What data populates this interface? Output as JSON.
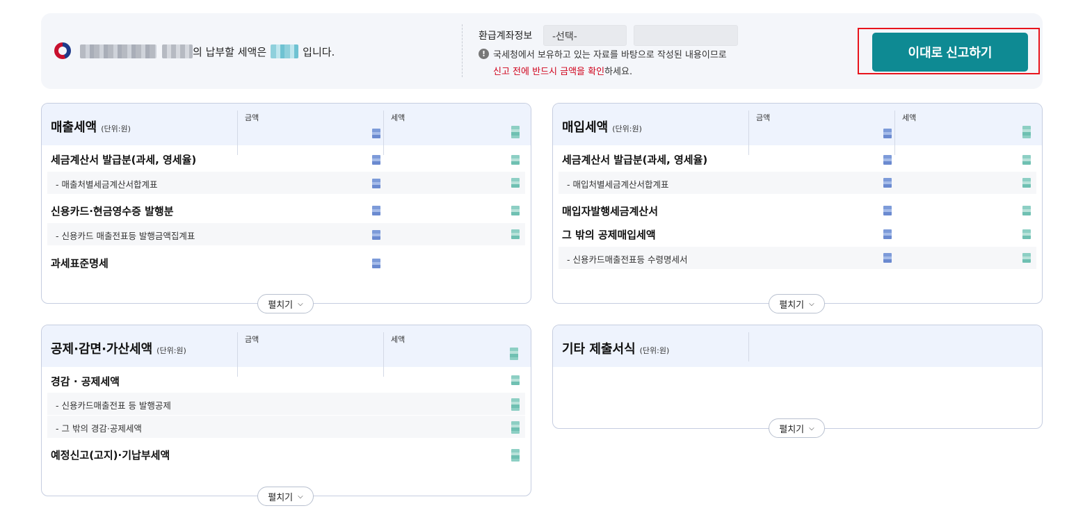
{
  "header": {
    "owner_suffix": "의 납부할 세액은",
    "owner_end": "입니다.",
    "refund_label": "환급계좌정보",
    "refund_select": "-선택-",
    "notice_line1": "국세청에서 보유하고 있는 자료를 바탕으로 작성된 내용이므로",
    "notice_red": "신고 전에 반드시 금액을 확인",
    "notice_tail": "하세요.",
    "submit_label": "이대로 신고하기"
  },
  "common": {
    "unit": "(단위:원)",
    "col_amount": "금액",
    "col_tax": "세액",
    "expand": "펼치기"
  },
  "sales": {
    "title": "매출세액",
    "rows": [
      {
        "label": "세금계산서 발급분(과세, 영세율)"
      },
      {
        "label": "- 매출처별세금계산서합계표"
      },
      {
        "label": "신용카드·현금영수증 발행분"
      },
      {
        "label": "- 신용카드 매출전표등 발행금액집계표"
      },
      {
        "label": "과세표준명세"
      }
    ]
  },
  "purchase": {
    "title": "매입세액",
    "rows": [
      {
        "label": "세금계산서 발급분(과세, 영세율)"
      },
      {
        "label": "- 매입처별세금계산서합계표"
      },
      {
        "label": "매입자발행세금계산서"
      },
      {
        "label": "그 밖의 공제매입세액"
      },
      {
        "label": "- 신용카드매출전표등 수령명세서"
      }
    ]
  },
  "deduction": {
    "title": "공제·감면·가산세액",
    "rows": [
      {
        "label": "경감 · 공제세액"
      },
      {
        "label": "- 신용카드매출전표 등 발행공제"
      },
      {
        "label": "- 그 밖의 경감·공제세액"
      },
      {
        "label": "예정신고(고지)·기납부세액"
      }
    ]
  },
  "other": {
    "title": "기타 제출서식"
  }
}
